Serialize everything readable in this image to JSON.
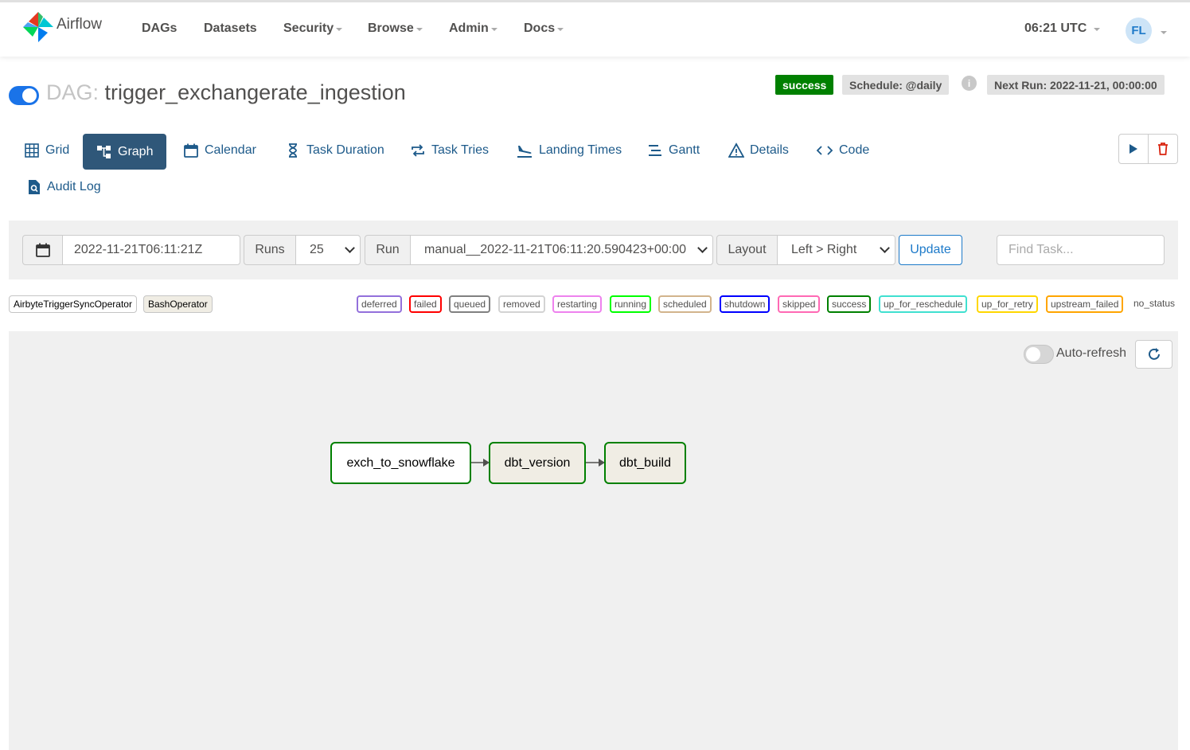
{
  "navbar": {
    "brand": "Airflow",
    "items": [
      {
        "label": "DAGs"
      },
      {
        "label": "Datasets"
      },
      {
        "label": "Security"
      },
      {
        "label": "Browse"
      },
      {
        "label": "Admin"
      },
      {
        "label": "Docs"
      }
    ],
    "clock": "06:21 UTC",
    "user_initials": "FL"
  },
  "dag": {
    "prefix": "DAG:",
    "name": "trigger_exchangerate_ingestion",
    "paused": false,
    "status_badge": "success",
    "schedule": "Schedule: @daily",
    "info_icon": "i",
    "next_run": "Next Run: 2022-11-21, 00:00:00"
  },
  "tabs": [
    {
      "label": "Grid",
      "icon": "grid-icon"
    },
    {
      "label": "Graph",
      "icon": "graph-icon",
      "active": true
    },
    {
      "label": "Calendar",
      "icon": "calendar-icon"
    },
    {
      "label": "Task Duration",
      "icon": "hourglass-icon"
    },
    {
      "label": "Task Tries",
      "icon": "repeat-icon"
    },
    {
      "label": "Landing Times",
      "icon": "landing-icon"
    },
    {
      "label": "Gantt",
      "icon": "gantt-icon"
    },
    {
      "label": "Details",
      "icon": "warning-triangle-icon"
    },
    {
      "label": "Code",
      "icon": "code-icon"
    },
    {
      "label": "Audit Log",
      "icon": "file-search-icon"
    }
  ],
  "filters": {
    "date_value": "2022-11-21T06:11:21Z",
    "runs_label": "Runs",
    "runs_value": "25",
    "run_label": "Run",
    "run_value": "manual__2022-11-21T06:11:20.590423+00:00",
    "layout_label": "Layout",
    "layout_value": "Left > Right",
    "update_label": "Update",
    "find_placeholder": "Find Task..."
  },
  "operators": [
    {
      "label": "AirbyteTriggerSyncOperator",
      "color": "#ffffff"
    },
    {
      "label": "BashOperator",
      "color": "#f0ede4"
    }
  ],
  "states": [
    {
      "label": "deferred",
      "color": "#9370db"
    },
    {
      "label": "failed",
      "color": "#ff0000"
    },
    {
      "label": "queued",
      "color": "#808080"
    },
    {
      "label": "removed",
      "color": "#d3d3d3"
    },
    {
      "label": "restarting",
      "color": "#ee82ee"
    },
    {
      "label": "running",
      "color": "#00ff00"
    },
    {
      "label": "scheduled",
      "color": "#d2b48c"
    },
    {
      "label": "shutdown",
      "color": "#0000ff"
    },
    {
      "label": "skipped",
      "color": "#ff69b4"
    },
    {
      "label": "success",
      "color": "#008000"
    },
    {
      "label": "up_for_reschedule",
      "color": "#40e0d0"
    },
    {
      "label": "up_for_retry",
      "color": "#ffd700"
    },
    {
      "label": "upstream_failed",
      "color": "#ffa500"
    }
  ],
  "no_status_label": "no_status",
  "graph": {
    "auto_refresh_label": "Auto-refresh",
    "auto_refresh_on": false,
    "nodes": [
      {
        "label": "exch_to_snowflake",
        "operator": "AirbyteTriggerSyncOperator",
        "state": "success"
      },
      {
        "label": "dbt_version",
        "operator": "BashOperator",
        "state": "success"
      },
      {
        "label": "dbt_build",
        "operator": "BashOperator",
        "state": "success"
      }
    ]
  }
}
